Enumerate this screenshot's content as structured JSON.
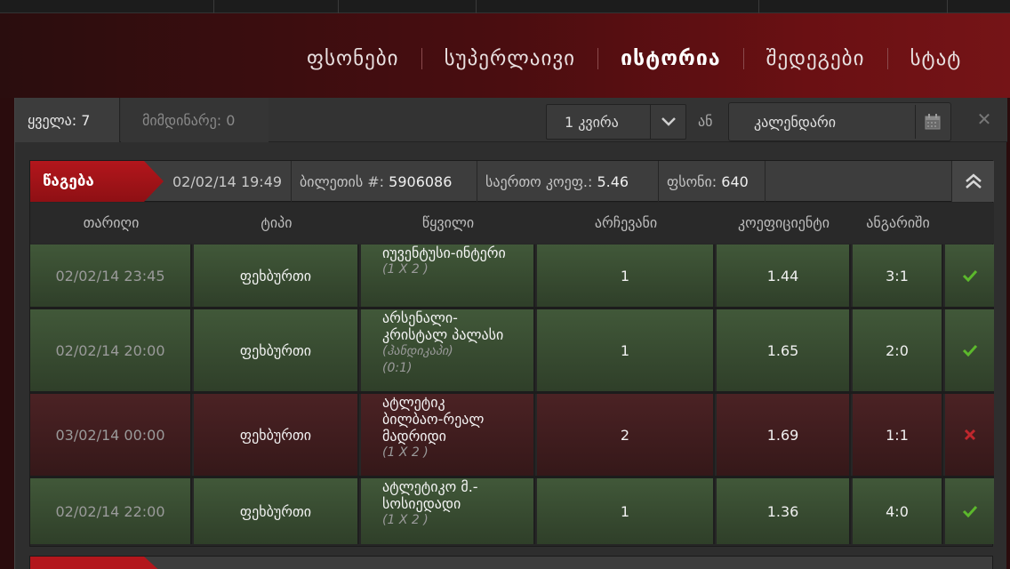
{
  "nav": {
    "items": [
      {
        "label": "ფსონები",
        "active": false
      },
      {
        "label": "სუპერლაივი",
        "active": false
      },
      {
        "label": "ისტორია",
        "active": true
      },
      {
        "label": "შედეგები",
        "active": false
      },
      {
        "label": "სტატ",
        "active": false
      }
    ]
  },
  "filters": {
    "all": "ყველა: 7",
    "current": "მიმდინარე: 0",
    "period": "1 კვირა",
    "or": "ან",
    "calendar": "კალენდარი",
    "close": "✕"
  },
  "ticket": {
    "tag": "წაგება",
    "date": "02/02/14 19:49",
    "ticket_label": "ბილეთის #:",
    "ticket_no": "5906086",
    "total_odds_label": "საერთო კოეფ.:",
    "total_odds": "5.46",
    "stake_label": "ფსონი:",
    "stake": "640"
  },
  "columns": [
    "თარიღი",
    "ტიპი",
    "წყვილი",
    "არჩევანი",
    "კოეფიციენტი",
    "ანგარიში"
  ],
  "rows": [
    {
      "date": "02/02/14 23:45",
      "type": "ფეხბურთი",
      "event": [
        "იუვენტუსი-ინტერი"
      ],
      "sub": [
        "(1 X 2 )"
      ],
      "pick": "1",
      "odds": "1.44",
      "score": "3:1",
      "result": "win"
    },
    {
      "date": "02/02/14 20:00",
      "type": "ფეხბურთი",
      "event": [
        "არსენალი-",
        "კრისტალ პალასი"
      ],
      "sub": [
        "(ჰანდიკაპი)",
        "(0:1)"
      ],
      "pick": "1",
      "odds": "1.65",
      "score": "2:0",
      "result": "win"
    },
    {
      "date": "03/02/14 00:00",
      "type": "ფეხბურთი",
      "event": [
        "ატლეტიკ",
        "ბილბაო-რეალ",
        "მადრიდი"
      ],
      "sub": [
        "(1 X 2 )"
      ],
      "pick": "2",
      "odds": "1.69",
      "score": "1:1",
      "result": "lose"
    },
    {
      "date": "02/02/14 22:00",
      "type": "ფეხბურთი",
      "event": [
        "ატლეტიკო მ.-",
        "სოსიედადი"
      ],
      "sub": [
        "(1 X 2 )"
      ],
      "pick": "1",
      "odds": "1.36",
      "score": "4:0",
      "result": "win"
    }
  ],
  "colors": {
    "win": "#5cb82c",
    "lose": "#c0272d",
    "accent": "#b3161c"
  }
}
